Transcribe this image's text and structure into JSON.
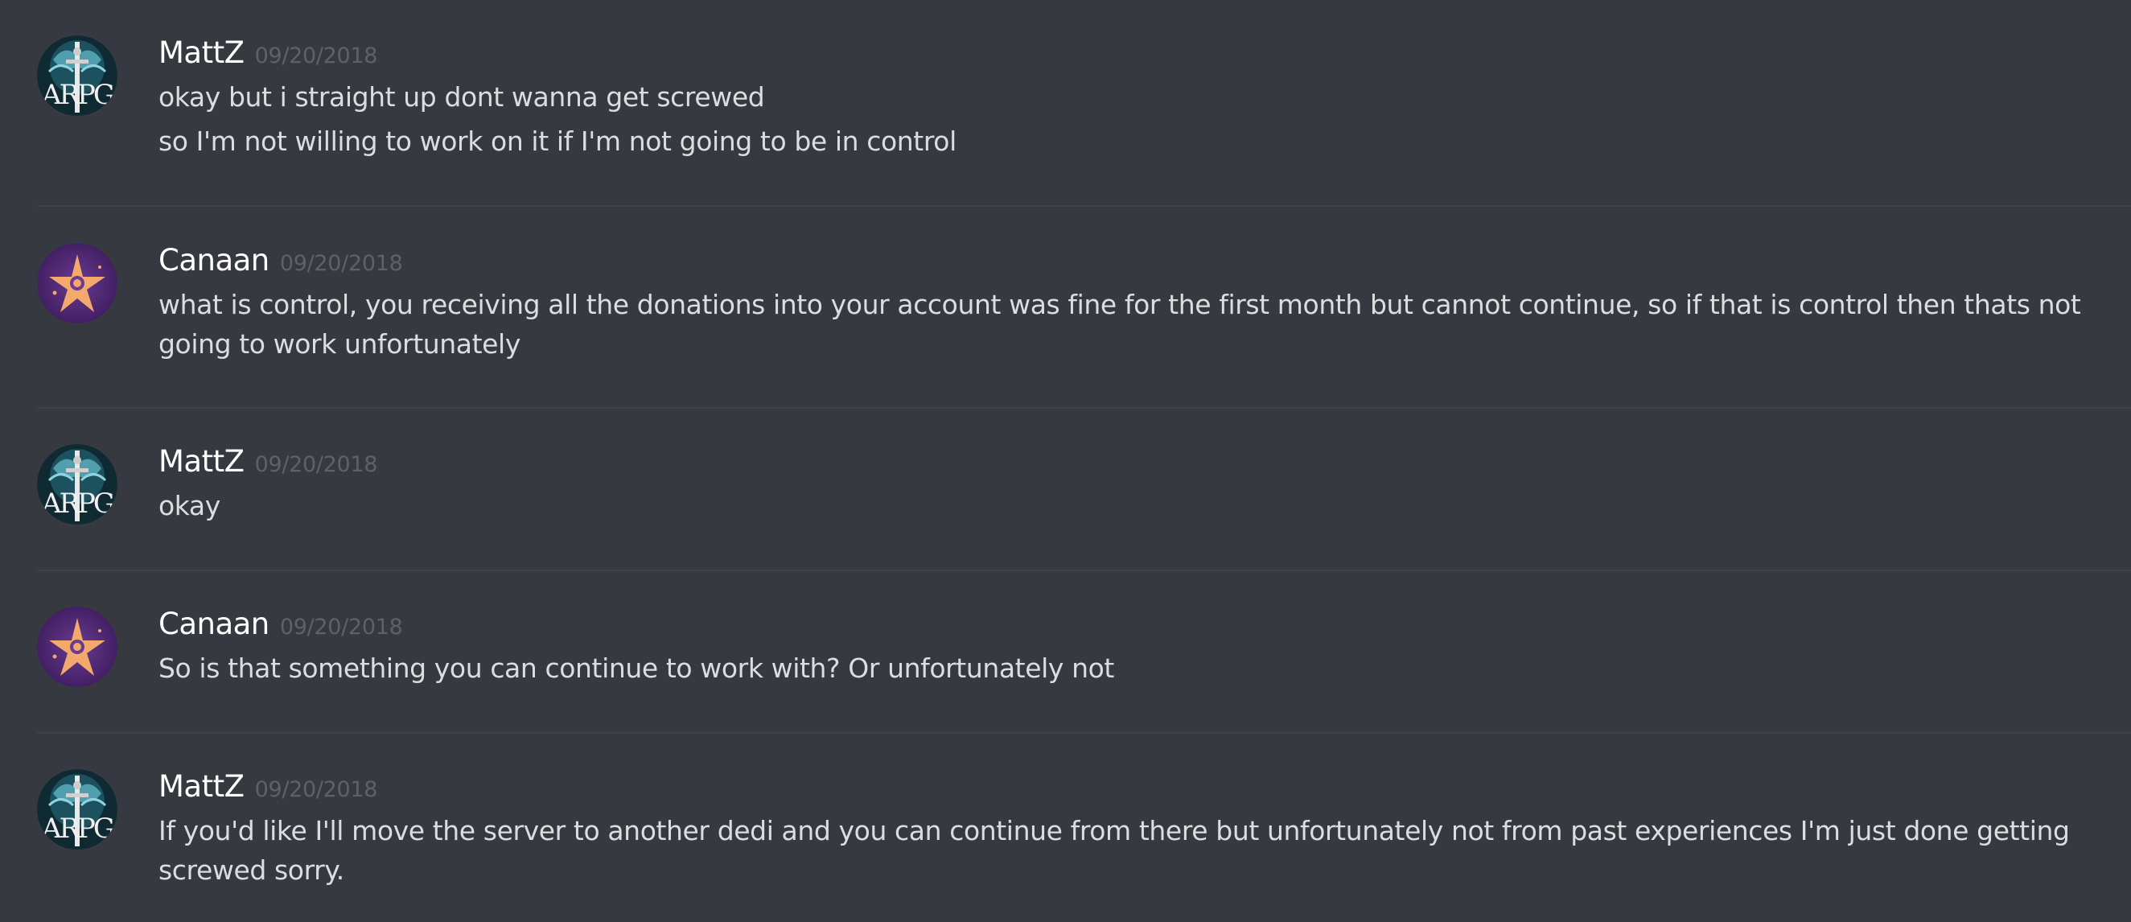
{
  "messages": [
    {
      "username": "MattZ",
      "timestamp": "09/20/2018",
      "avatar": "sword-emblem-avatar",
      "lines": [
        "okay but i straight up dont wanna get screwed",
        "so I'm not willing to work on it if I'm not going to be in control"
      ]
    },
    {
      "username": "Canaan",
      "timestamp": "09/20/2018",
      "avatar": "purple-star-avatar",
      "lines": [
        "what is control, you receiving all the donations into your account was fine for the first month but cannot continue, so if that is control then thats not going to work unfortunately"
      ]
    },
    {
      "username": "MattZ",
      "timestamp": "09/20/2018",
      "avatar": "sword-emblem-avatar",
      "lines": [
        "okay"
      ]
    },
    {
      "username": "Canaan",
      "timestamp": "09/20/2018",
      "avatar": "purple-star-avatar",
      "lines": [
        "So is that something you can continue to work with? Or unfortunately not"
      ]
    },
    {
      "username": "MattZ",
      "timestamp": "09/20/2018",
      "avatar": "sword-emblem-avatar",
      "lines": [
        "If you'd like I'll move the server to another dedi and you can continue from there but unfortunately not from past experiences I'm just done getting screwed sorry."
      ]
    }
  ],
  "avatar_text": {
    "mattz": "ARPG"
  },
  "colors": {
    "background": "#36393f",
    "username": "#ffffff",
    "timestamp": "#5e6168",
    "message_text": "#dcddde",
    "divider": "#3e4147"
  }
}
